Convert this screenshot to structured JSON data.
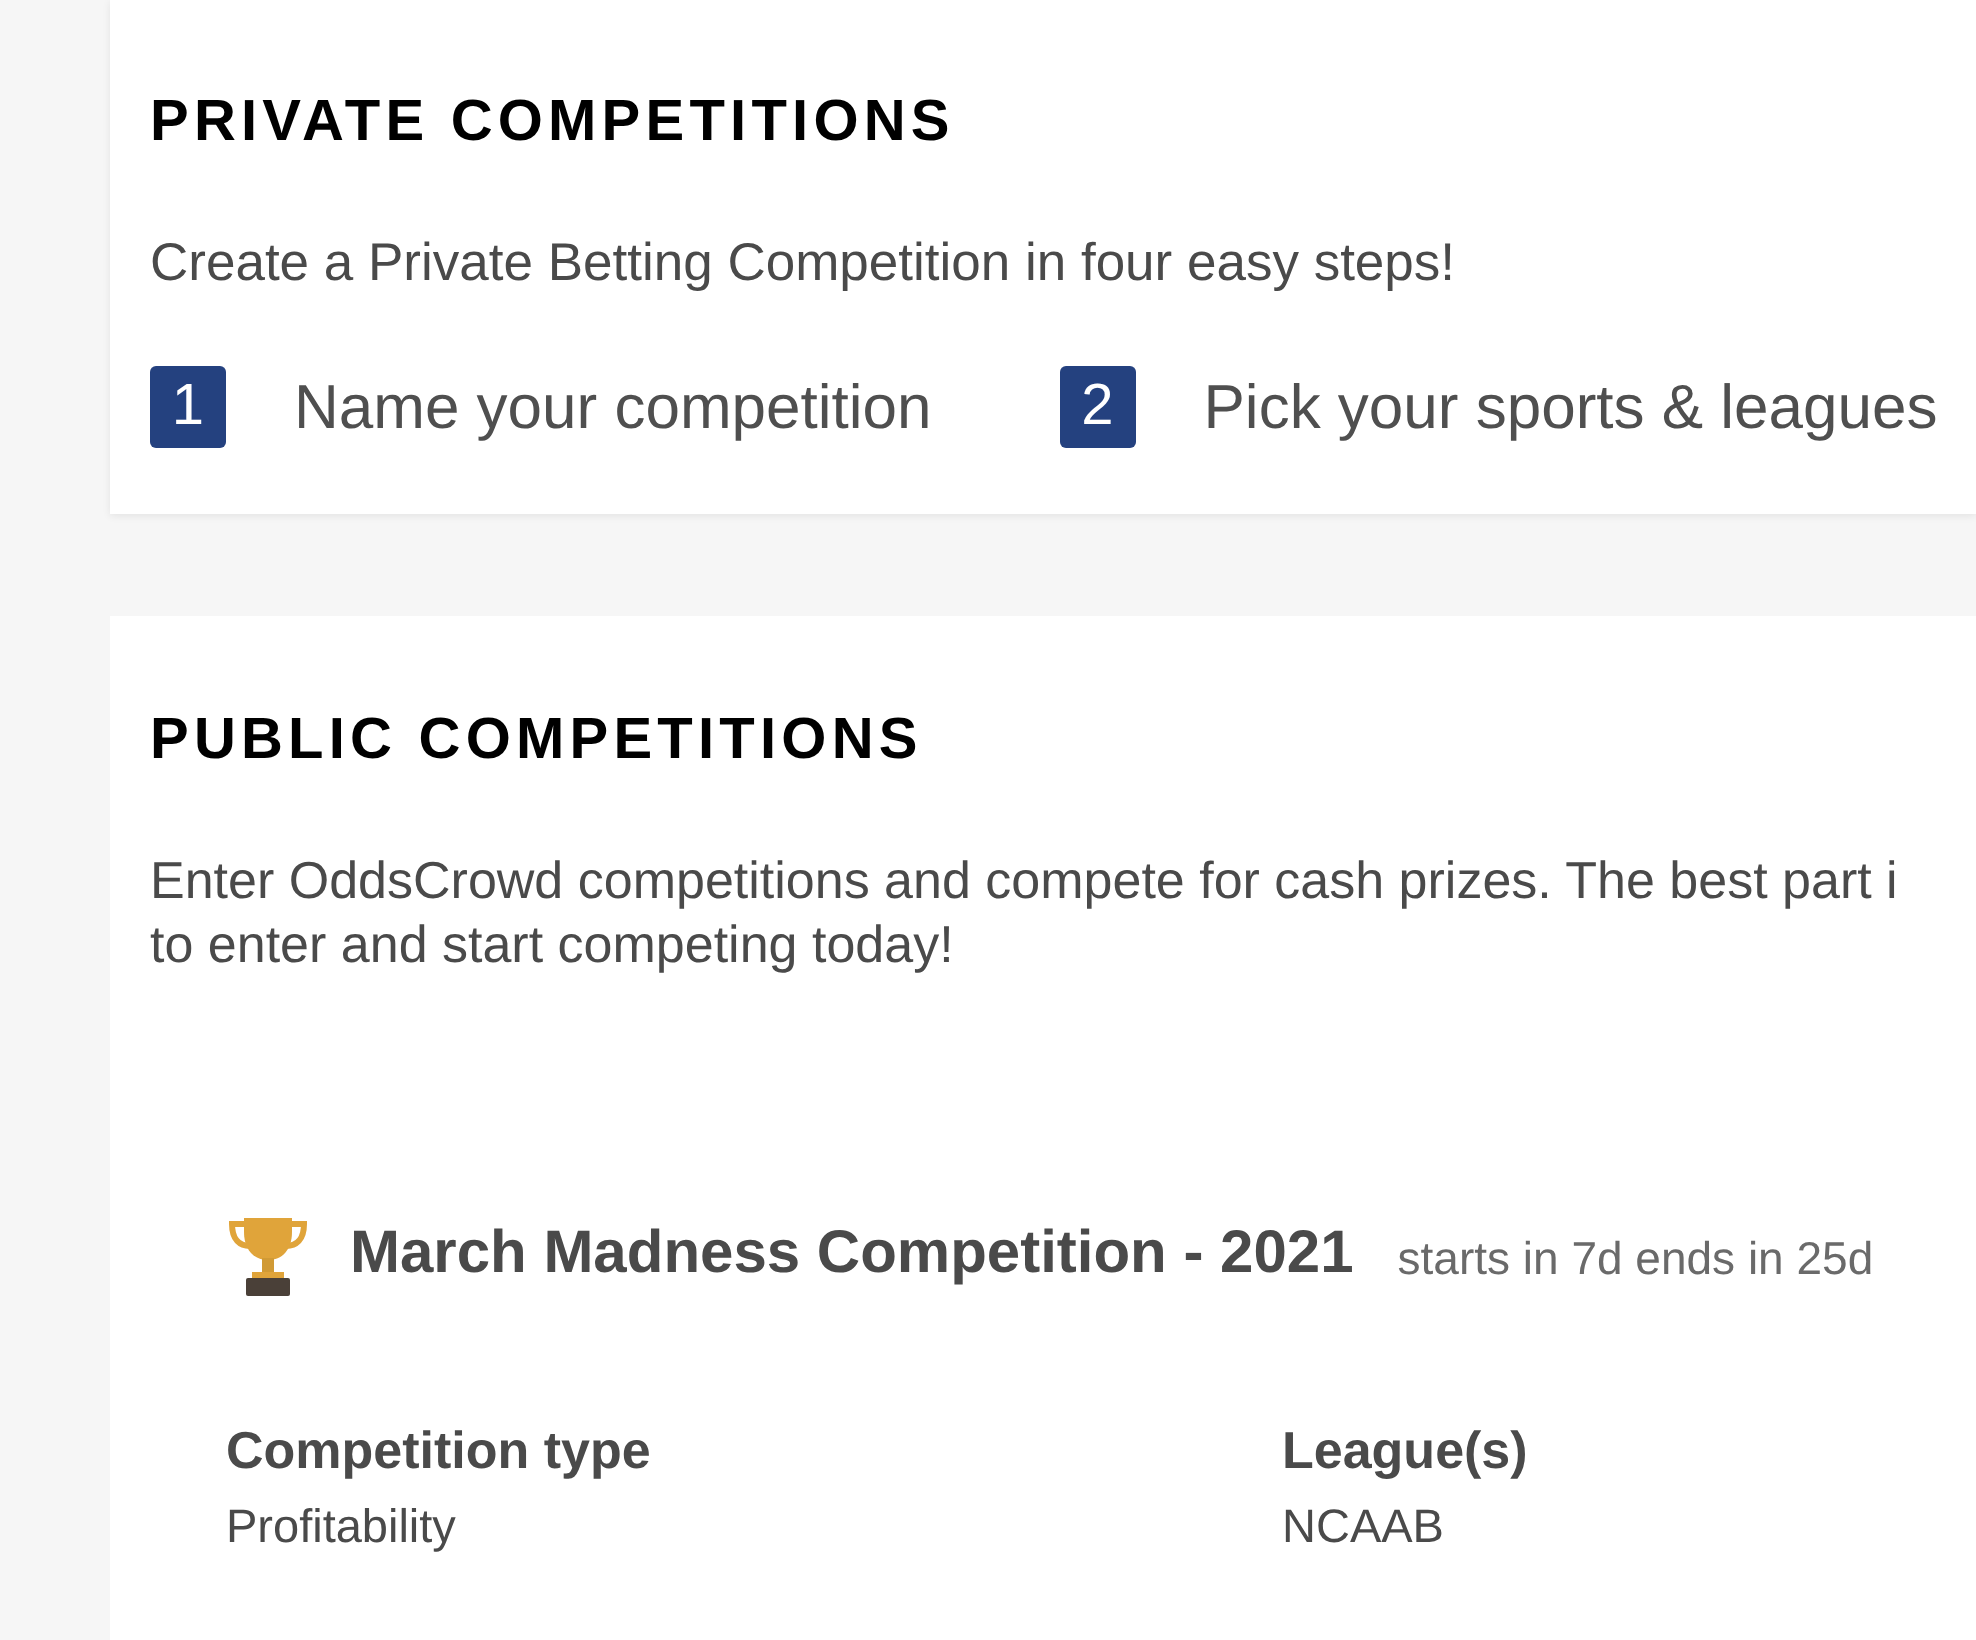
{
  "private_section": {
    "title": "PRIVATE COMPETITIONS",
    "intro": "Create a Private Betting Competition in four easy steps!",
    "steps": [
      {
        "number": "1",
        "label": "Name your competition"
      },
      {
        "number": "2",
        "label": "Pick your sports & leagues"
      }
    ]
  },
  "public_section": {
    "title": "PUBLIC COMPETITIONS",
    "description_lines": [
      "Enter OddsCrowd competitions and compete for cash prizes. The best part i",
      "to enter and start competing today!"
    ],
    "competitions": [
      {
        "title": "March Madness Competition - 2021",
        "timing": "starts in 7d ends in 25d",
        "details": [
          {
            "label": "Competition type",
            "value": "Profitability"
          },
          {
            "label": "League(s)",
            "value": "NCAAB"
          }
        ]
      }
    ]
  }
}
